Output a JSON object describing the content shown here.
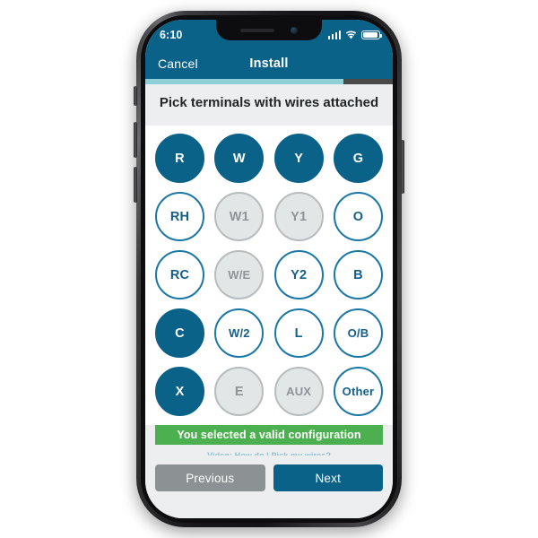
{
  "device": {
    "status_bar": {
      "time": "6:10",
      "icons": [
        "signal-icon",
        "wifi-icon",
        "battery-icon"
      ]
    }
  },
  "nav": {
    "cancel_label": "Cancel",
    "title": "Install",
    "progress_percent": 80
  },
  "page": {
    "title": "Pick terminals with wires attached"
  },
  "terminals": {
    "rows": [
      [
        {
          "label": "R",
          "state": "selected"
        },
        {
          "label": "W",
          "state": "selected"
        },
        {
          "label": "Y",
          "state": "selected"
        },
        {
          "label": "G",
          "state": "selected"
        }
      ],
      [
        {
          "label": "RH",
          "state": "available"
        },
        {
          "label": "W1",
          "state": "disabled"
        },
        {
          "label": "Y1",
          "state": "disabled"
        },
        {
          "label": "O",
          "state": "available"
        }
      ],
      [
        {
          "label": "RC",
          "state": "available"
        },
        {
          "label": "W/E",
          "state": "disabled"
        },
        {
          "label": "Y2",
          "state": "available"
        },
        {
          "label": "B",
          "state": "available"
        }
      ],
      [
        {
          "label": "C",
          "state": "selected"
        },
        {
          "label": "W/2",
          "state": "available"
        },
        {
          "label": "L",
          "state": "available"
        },
        {
          "label": "O/B",
          "state": "available"
        }
      ],
      [
        {
          "label": "X",
          "state": "selected"
        },
        {
          "label": "E",
          "state": "disabled"
        },
        {
          "label": "AUX",
          "state": "disabled"
        },
        {
          "label": "Other",
          "state": "available"
        }
      ]
    ]
  },
  "status_banner": {
    "message": "You selected a valid configuration",
    "color": "#4cb050"
  },
  "video_link": {
    "label": "Video: How do I Pick my wires?"
  },
  "footer": {
    "previous_label": "Previous",
    "next_label": "Next"
  },
  "colors": {
    "brand_blue": "#0b6288",
    "outline_blue": "#1a77a6",
    "disabled_gray": "#e3e6e7",
    "success_green": "#4cb050",
    "progress_teal": "#8fcfd8"
  }
}
